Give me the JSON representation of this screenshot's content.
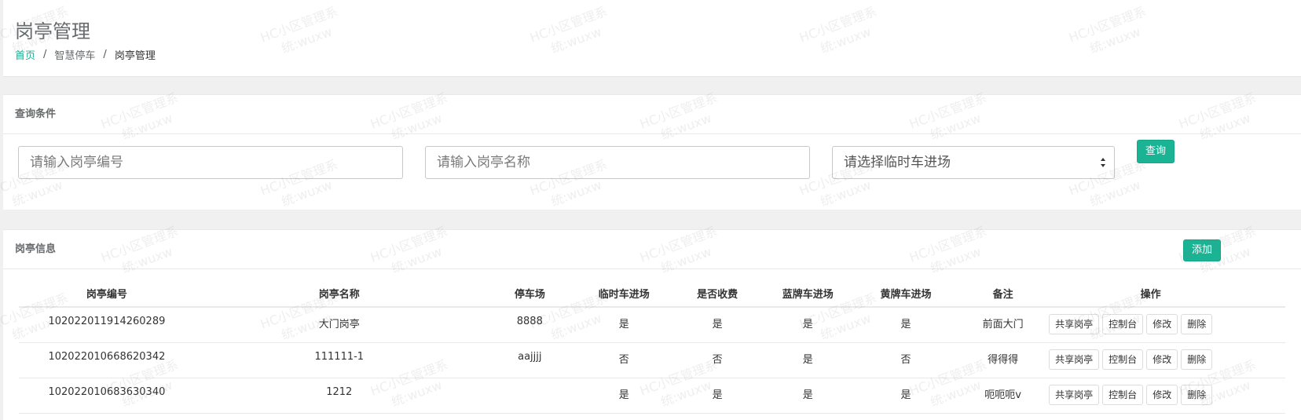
{
  "header": {
    "title": "岗亭管理",
    "breadcrumb": [
      "首页",
      "智慧停车",
      "岗亭管理"
    ]
  },
  "query": {
    "title": "查询条件",
    "booth_id_placeholder": "请输入岗亭编号",
    "booth_name_placeholder": "请输入岗亭名称",
    "temp_car_select": "请选择临时车进场",
    "search_button": "查询"
  },
  "info": {
    "title": "岗亭信息",
    "add_button": "添加",
    "columns": [
      "岗亭编号",
      "岗亭名称",
      "停车场",
      "临时车进场",
      "是否收费",
      "蓝牌车进场",
      "黄牌车进场",
      "备注",
      "操作"
    ],
    "rows": [
      {
        "id": "102022011914260289",
        "name": "大门岗亭",
        "lot": "8888",
        "temp": "是",
        "charge": "是",
        "blue": "是",
        "yellow": "是",
        "remark": "前面大门"
      },
      {
        "id": "102022010668620342",
        "name": "111111-1",
        "lot": "aajjjj",
        "temp": "否",
        "charge": "否",
        "blue": "是",
        "yellow": "否",
        "remark": "得得得"
      },
      {
        "id": "102022010683630340",
        "name": "1212",
        "lot": "",
        "temp": "是",
        "charge": "是",
        "blue": "是",
        "yellow": "是",
        "remark": "呃呃呃v"
      }
    ],
    "ops": [
      "共享岗亭",
      "控制台",
      "修改",
      "删除"
    ]
  },
  "watermark": {
    "line1": "HC小区管理系",
    "line2": "统:wuxw"
  },
  "colors": {
    "accent": "#1ab394",
    "background": "#f0f0f0"
  }
}
